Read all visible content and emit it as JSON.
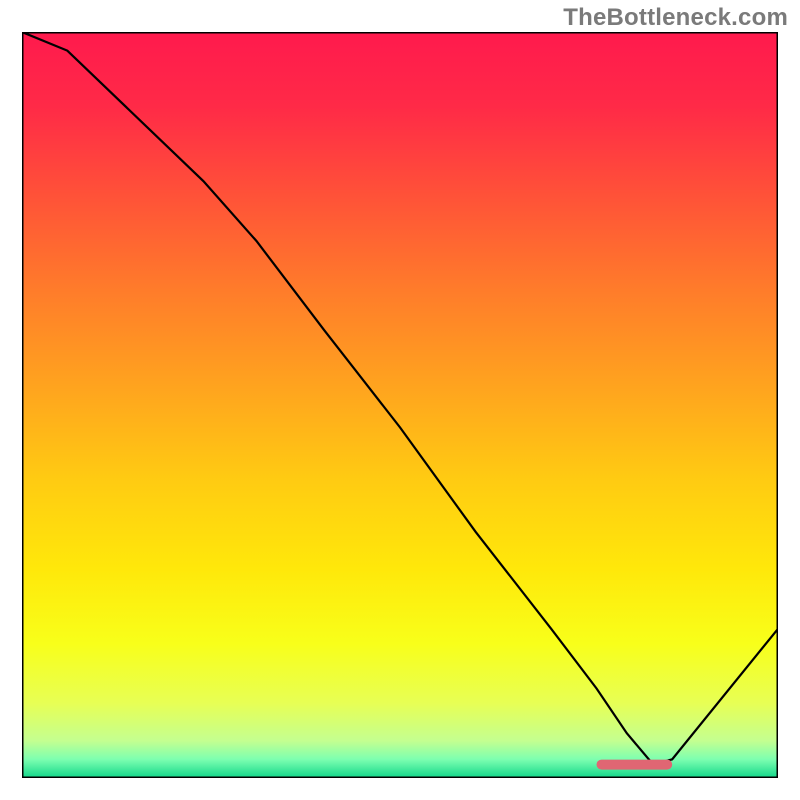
{
  "watermark": "TheBottleneck.com",
  "chart_data": {
    "type": "line",
    "title": "",
    "xlabel": "",
    "ylabel": "",
    "xlim": [
      0,
      100
    ],
    "ylim": [
      0,
      100
    ],
    "grid": false,
    "legend": false,
    "series": [
      {
        "name": "curve",
        "x": [
          0,
          6,
          24,
          31,
          40,
          50,
          60,
          70,
          76,
          80,
          83.5,
          86,
          100
        ],
        "y": [
          100,
          97.5,
          80,
          72,
          60,
          47,
          33,
          20,
          12,
          6,
          1.8,
          2.5,
          20
        ],
        "color": "#000000"
      }
    ],
    "marker": {
      "x_start": 76,
      "x_end": 86,
      "y": 1.8,
      "color": "#e06673"
    },
    "background_gradient": {
      "stops": [
        {
          "offset": 0.0,
          "color": "#ff1a4d"
        },
        {
          "offset": 0.1,
          "color": "#ff2a47"
        },
        {
          "offset": 0.22,
          "color": "#ff5238"
        },
        {
          "offset": 0.35,
          "color": "#ff7d2a"
        },
        {
          "offset": 0.48,
          "color": "#ffa51e"
        },
        {
          "offset": 0.6,
          "color": "#ffcb12"
        },
        {
          "offset": 0.72,
          "color": "#ffe80a"
        },
        {
          "offset": 0.82,
          "color": "#f8ff1a"
        },
        {
          "offset": 0.9,
          "color": "#e7ff55"
        },
        {
          "offset": 0.95,
          "color": "#c4ff90"
        },
        {
          "offset": 0.975,
          "color": "#7dffb0"
        },
        {
          "offset": 1.0,
          "color": "#11d68a"
        }
      ]
    }
  }
}
